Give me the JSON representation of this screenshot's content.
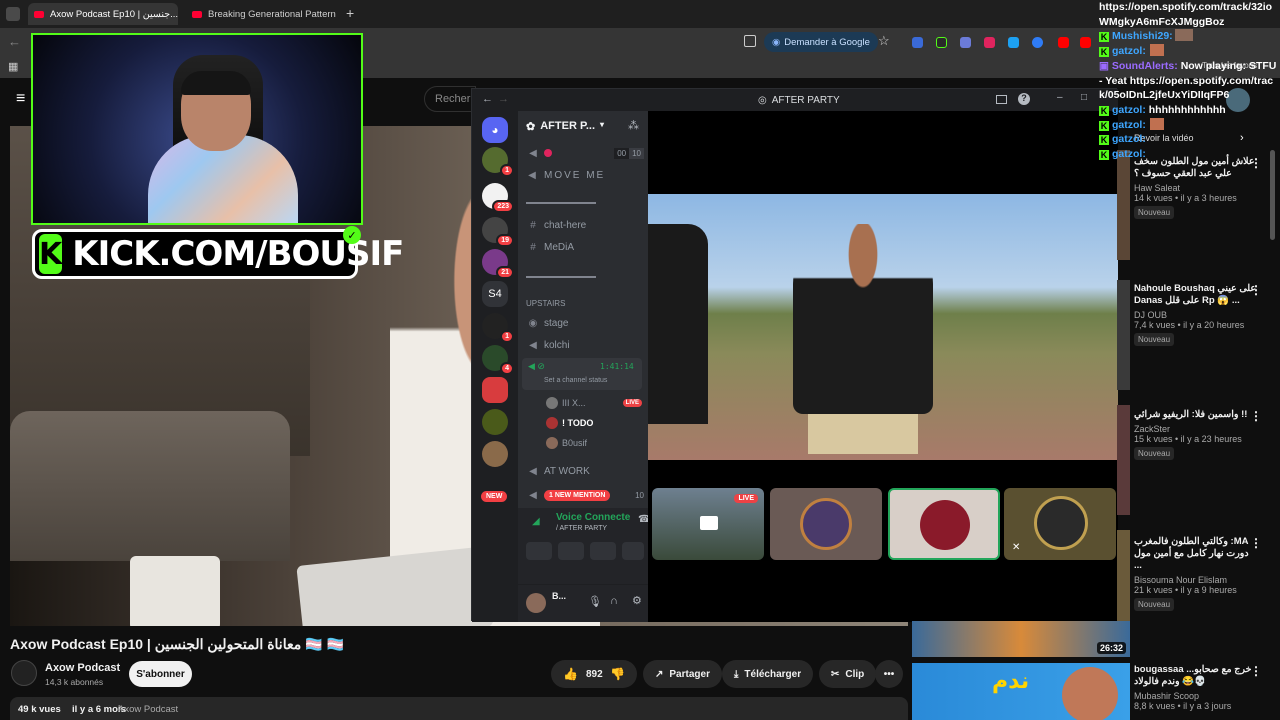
{
  "browser": {
    "tabs": [
      {
        "label": "Axow Podcast Ep10 | جنسين..."
      },
      {
        "label": "Breaking Generational Patterns..."
      }
    ],
    "new_tab": "+",
    "tab_close": "×",
    "demander_google": "Demander à Google",
    "bookmarks_label": "Tous les favoris"
  },
  "youtube": {
    "search_placeholder": "Recherc",
    "video_title": "Axow Podcast Ep10 | معاناة المتحولين الجنسين 🏳️‍⚧️ 🏳️‍⚧️",
    "channel_name": "Axow Podcast",
    "subscribers": "14,3 k abonnés",
    "subscribe_label": "S'abonner",
    "likes": "892",
    "share_label": "Partager",
    "download_label": "Télécharger",
    "clip_label": "Clip",
    "more": "•••",
    "views": "49 k vues",
    "posted": "il y a 6 mois",
    "channel_tag": "Axow Podcast"
  },
  "sidebar": {
    "next_label": "Revoir la vidéo",
    "items": [
      {
        "title": "علاش أمين مول الطلون سخف علي عبد العقي حسوف ؟",
        "channel": "Haw Saleat",
        "meta": "14 k vues • il y a 3 heures",
        "badge": "Nouveau"
      },
      {
        "title": "Nahoule Boushaq على عيني Danas على قلل Rp 😱 ...",
        "channel": "DJ OUB",
        "meta": "7,4 k vues • il y a 20 heures",
        "badge": "Nouveau"
      },
      {
        "title": "واسمين فلا: الريفيو شرائي !!",
        "channel": "ZackSter",
        "meta": "15 k vues • il y a 23 heures",
        "badge": "Nouveau"
      },
      {
        "title": "وكالتي الطلون فالمغرب :MA دورت نهار كامل مع أمين مول ...",
        "channel": "Bissouma Nour Elislam",
        "meta": "21 k vues • il y a 9 heures",
        "badge": "Nouveau"
      },
      {
        "title": "bougassaa خرج مع صحابو... وندم فالولاد 😂💀",
        "channel": "Mubashir Scoop",
        "meta": "8,8 k vues • il y a 3 jours",
        "badge": ""
      }
    ],
    "duration": "26:32",
    "thumb_text": "ندم"
  },
  "stream": {
    "kick_banner": "KICK.COM/BOUSIF",
    "kick_logo": "K"
  },
  "chat": {
    "lines": [
      {
        "user": "",
        "text": "https://open.spotify.com/track/32ioWMgkyA6mFcXJMggBoz",
        "kick": false
      },
      {
        "user": "Mushishi29:",
        "text": "",
        "kick": true
      },
      {
        "user": "gatzol:",
        "text": "",
        "kick": true
      },
      {
        "user": "SoundAlerts:",
        "text": "Now playing: STFU - Yeat https://open.spotify.com/track/05oIDnL2jfeUxYiDIIqFP6",
        "kick": false
      },
      {
        "user": "gatzol:",
        "text": "hhhhhhhhhhhh",
        "kick": true
      },
      {
        "user": "gatzol:",
        "text": "",
        "kick": true
      },
      {
        "user": "gatzol:",
        "text": "",
        "kick": true
      },
      {
        "user": "gatzol:",
        "text": "",
        "kick": true
      }
    ]
  },
  "discord": {
    "title": "AFTER PARTY",
    "server": "AFTER P...",
    "guild_badges": [
      "1",
      "223",
      "19",
      "21",
      "S4",
      "1",
      "4"
    ],
    "new_badge": "NEW",
    "channels": {
      "top_counts": [
        "00",
        "10"
      ],
      "move_me": "MOVE ME",
      "chat_here": "chat-here",
      "media": "MeDiA",
      "upstairs": "UPSTAIRS",
      "stage": "stage",
      "kolchi": "kolchi",
      "timer": "1:41:14",
      "status": "Set a channel status",
      "users": [
        {
          "name": "III X...",
          "live": "LIVE"
        },
        {
          "name": "! TODO",
          "live": ""
        },
        {
          "name": "B0usif",
          "live": ""
        }
      ],
      "at_work": "AT WORK",
      "mention": "1 NEW MENTION",
      "mention_count": "10"
    },
    "voice": {
      "connected": "Voice Connecte",
      "channel": "/ AFTER PARTY"
    },
    "user": {
      "name": "B..."
    },
    "tile_live": "LIVE"
  }
}
